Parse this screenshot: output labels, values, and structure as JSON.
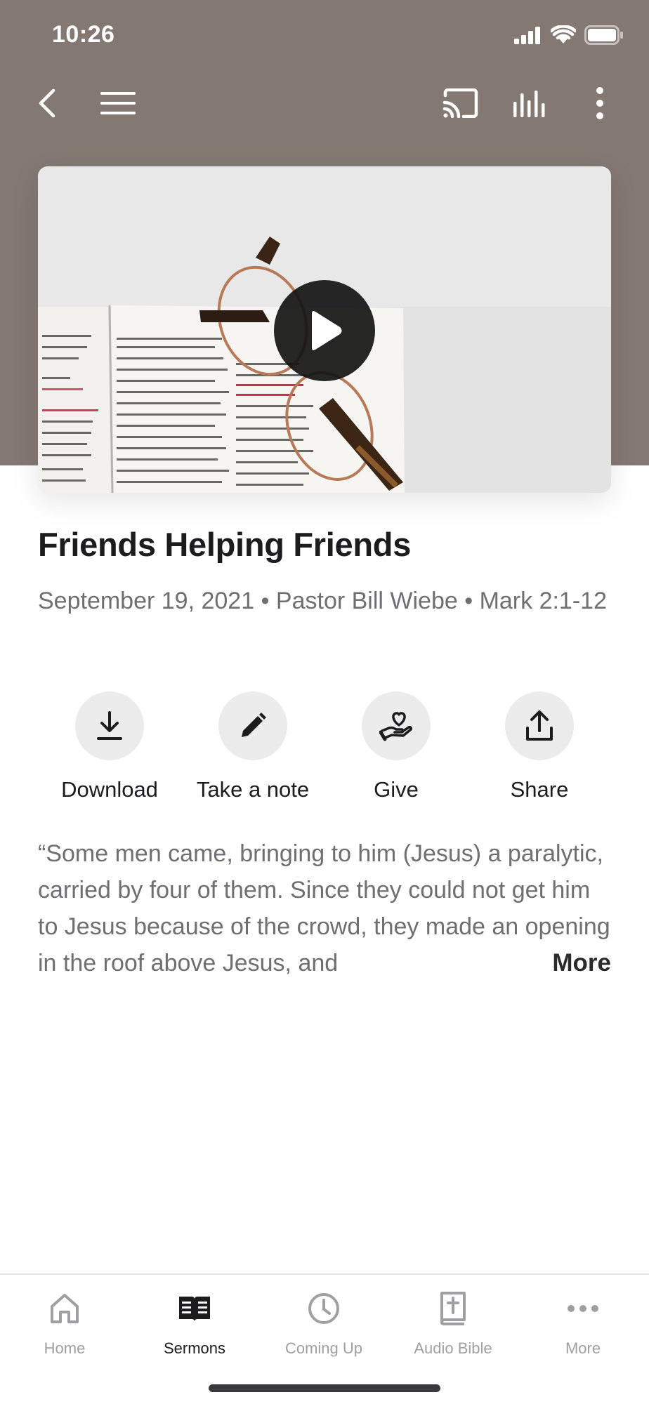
{
  "status_bar": {
    "time": "10:26"
  },
  "colors": {
    "header_bg": "#847873",
    "accent": "#1c1c1e",
    "muted_text": "#6e6e73",
    "inactive_tab": "#a0a0a4"
  },
  "nav": {
    "icons": [
      "back-icon",
      "menu-icon",
      "cast-icon",
      "audio-icon",
      "more-vertical-icon"
    ]
  },
  "video": {
    "thumbnail_subject": "open-bible-with-glasses",
    "play_icon": "play-icon"
  },
  "sermon": {
    "title": "Friends Helping Friends",
    "meta": "September 19, 2021 • Pastor Bill Wiebe • Mark 2:1-12",
    "description": "“Some men came, bringing to him (Jesus) a paralytic, carried by four of them. Since they could not get him to Jesus because of the crowd, they made an opening in the roof above Jesus, and",
    "more_label": "More"
  },
  "actions": [
    {
      "label": "Download",
      "icon": "download-icon"
    },
    {
      "label": "Take a note",
      "icon": "pencil-icon"
    },
    {
      "label": "Give",
      "icon": "give-heart-hand-icon"
    },
    {
      "label": "Share",
      "icon": "share-icon"
    }
  ],
  "tabs": [
    {
      "label": "Home",
      "icon": "home-icon",
      "active": false
    },
    {
      "label": "Sermons",
      "icon": "book-icon",
      "active": true
    },
    {
      "label": "Coming Up",
      "icon": "clock-icon",
      "active": false
    },
    {
      "label": "Audio Bible",
      "icon": "bible-icon",
      "active": false
    },
    {
      "label": "More",
      "icon": "more-horizontal-icon",
      "active": false
    }
  ]
}
